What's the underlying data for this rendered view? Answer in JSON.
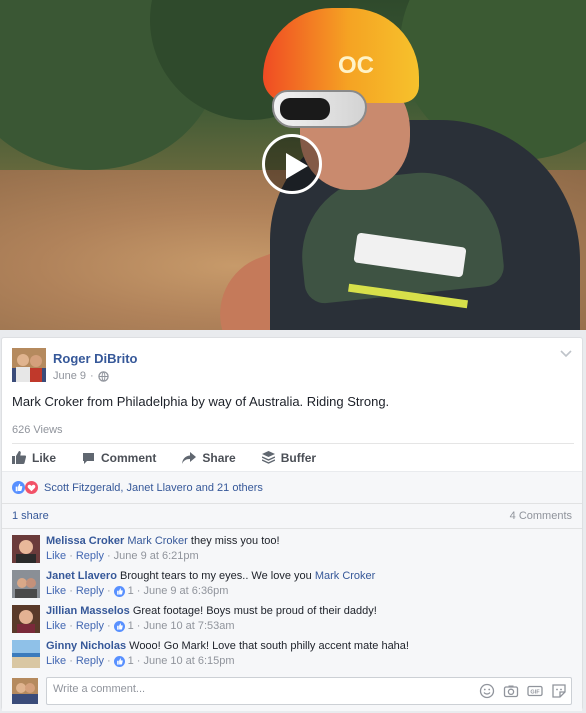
{
  "post": {
    "author": "Roger DiBrito",
    "date": "June 9",
    "text": "Mark Croker from Philadelphia by way of Australia. Riding Strong.",
    "views": "626 Views",
    "video": {
      "helmet_text": "OC"
    }
  },
  "actions": {
    "like": "Like",
    "comment": "Comment",
    "share": "Share",
    "buffer": "Buffer"
  },
  "reactions": {
    "names": "Scott Fitzgerald, Janet Llavero and 21 others"
  },
  "summary": {
    "shares": "1 share",
    "comments": "4 Comments"
  },
  "comments": [
    {
      "name": "Melissa Croker",
      "mention": "Mark Croker",
      "text": " they miss you too!",
      "like": "Like",
      "reply": "Reply",
      "likes": "",
      "time": "June 9 at 6:21pm"
    },
    {
      "name": "Janet Llavero",
      "text": " Brought tears to my eyes.. We love you ",
      "mention": "Mark Croker",
      "like": "Like",
      "reply": "Reply",
      "likes": "1",
      "time": "June 9 at 6:36pm"
    },
    {
      "name": "Jillian Masselos",
      "text": " Great footage! Boys must be proud of their daddy!",
      "like": "Like",
      "reply": "Reply",
      "likes": "1",
      "time": "June 10 at 7:53am"
    },
    {
      "name": "Ginny Nicholas",
      "text": " Wooo! Go Mark! Love that south philly accent mate haha!",
      "like": "Like",
      "reply": "Reply",
      "likes": "1",
      "time": "June 10 at 6:15pm"
    }
  ],
  "composer": {
    "placeholder": "Write a comment..."
  },
  "icons": [
    "play-icon",
    "globe-icon",
    "chevron-down-icon",
    "thumbs-up-icon",
    "comment-icon",
    "share-arrow-icon",
    "buffer-icon",
    "like-reaction-icon",
    "love-reaction-icon",
    "emoji-icon",
    "camera-icon",
    "gif-icon",
    "sticker-icon"
  ],
  "colors": {
    "link": "#365899",
    "brand": "#4267b2",
    "love": "#f25268",
    "muted": "#90949c"
  }
}
